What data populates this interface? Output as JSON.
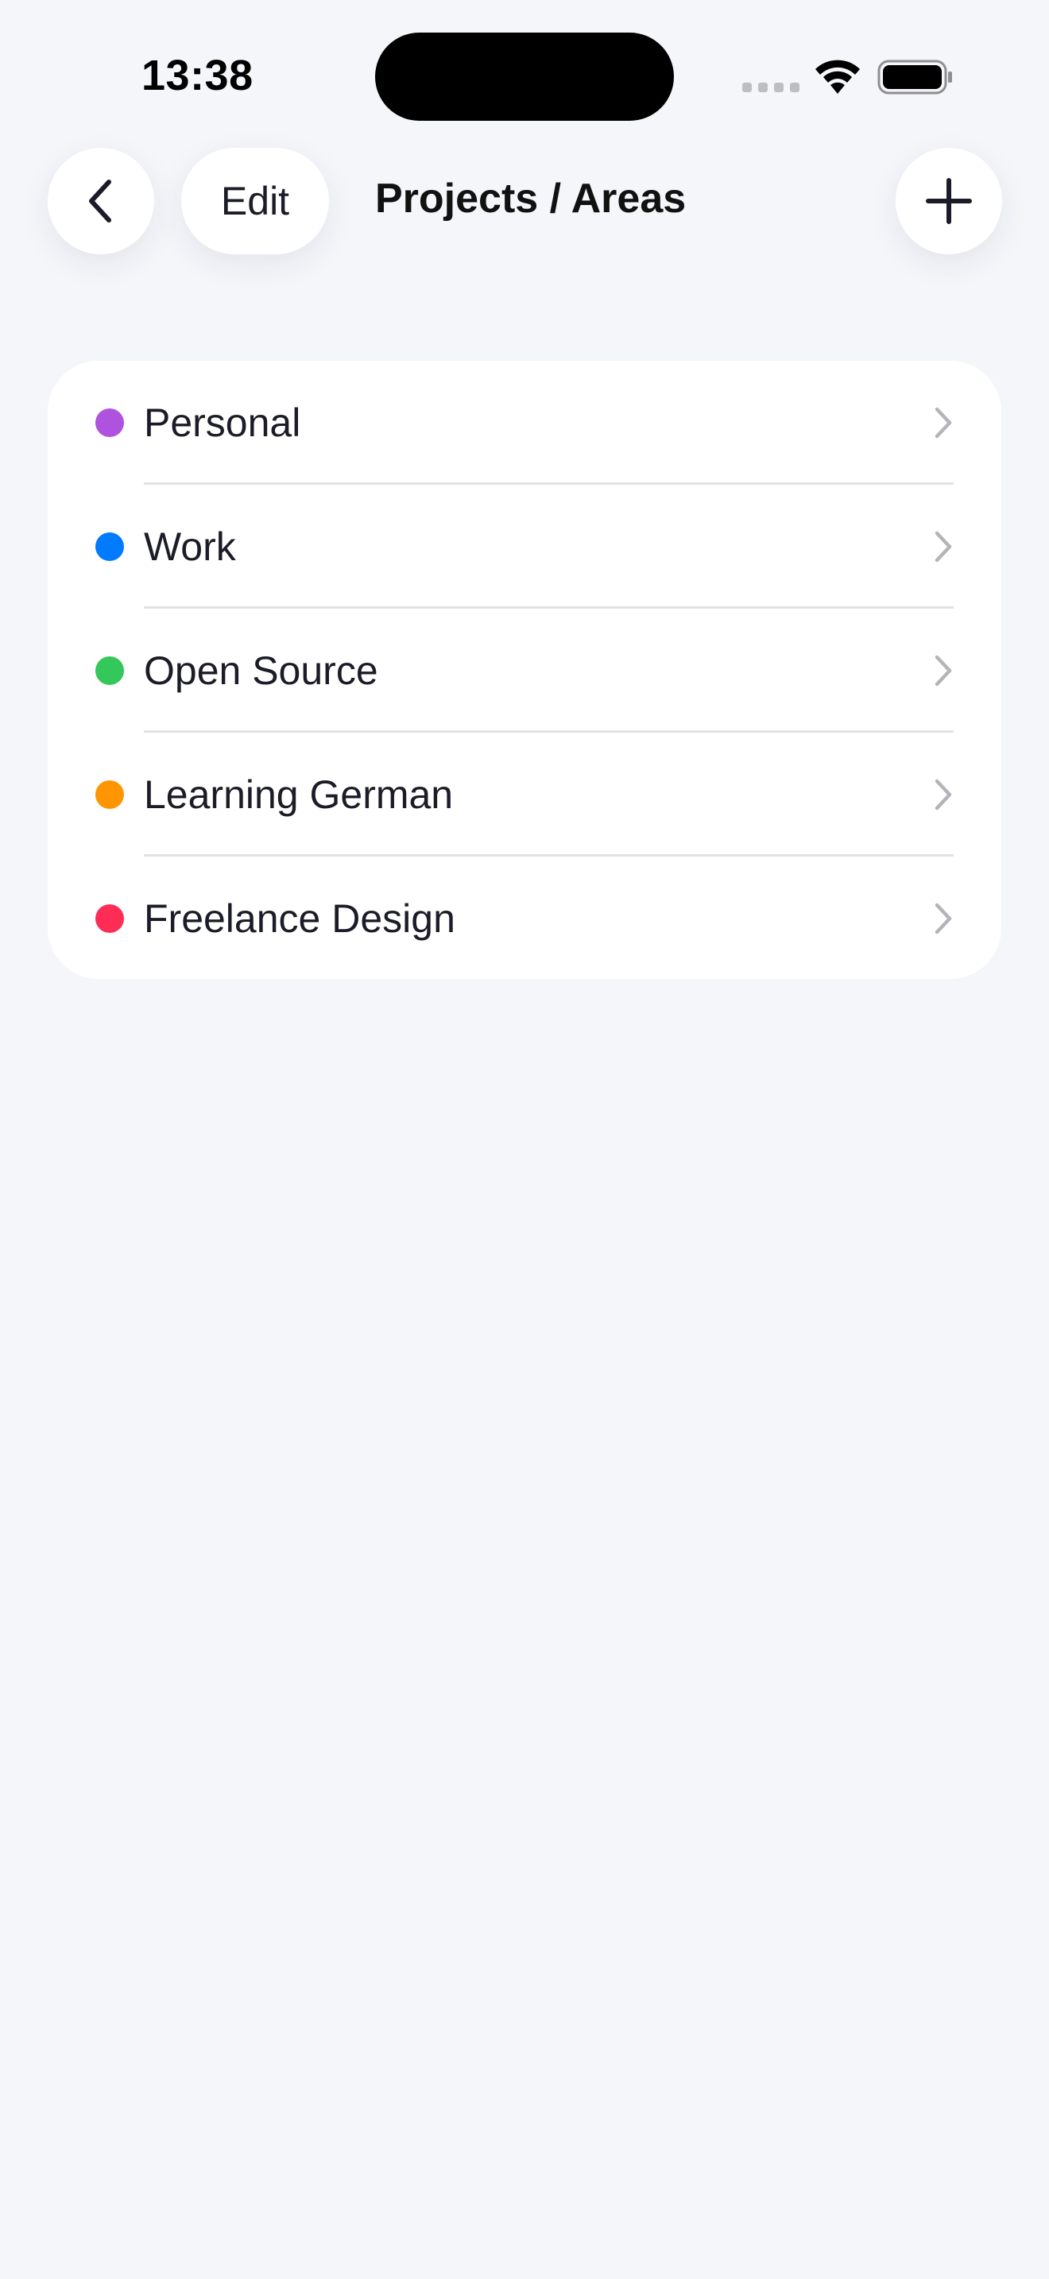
{
  "status_bar": {
    "time": "13:38"
  },
  "nav": {
    "edit_label": "Edit",
    "title": "Projects / Areas",
    "back_icon": "chevron-left-icon",
    "add_icon": "plus-icon"
  },
  "projects": [
    {
      "label": "Personal",
      "color": "#af52de"
    },
    {
      "label": "Work",
      "color": "#007aff"
    },
    {
      "label": "Open Source",
      "color": "#34c759"
    },
    {
      "label": "Learning German",
      "color": "#ff9500"
    },
    {
      "label": "Freelance Design",
      "color": "#ff2d55"
    }
  ]
}
